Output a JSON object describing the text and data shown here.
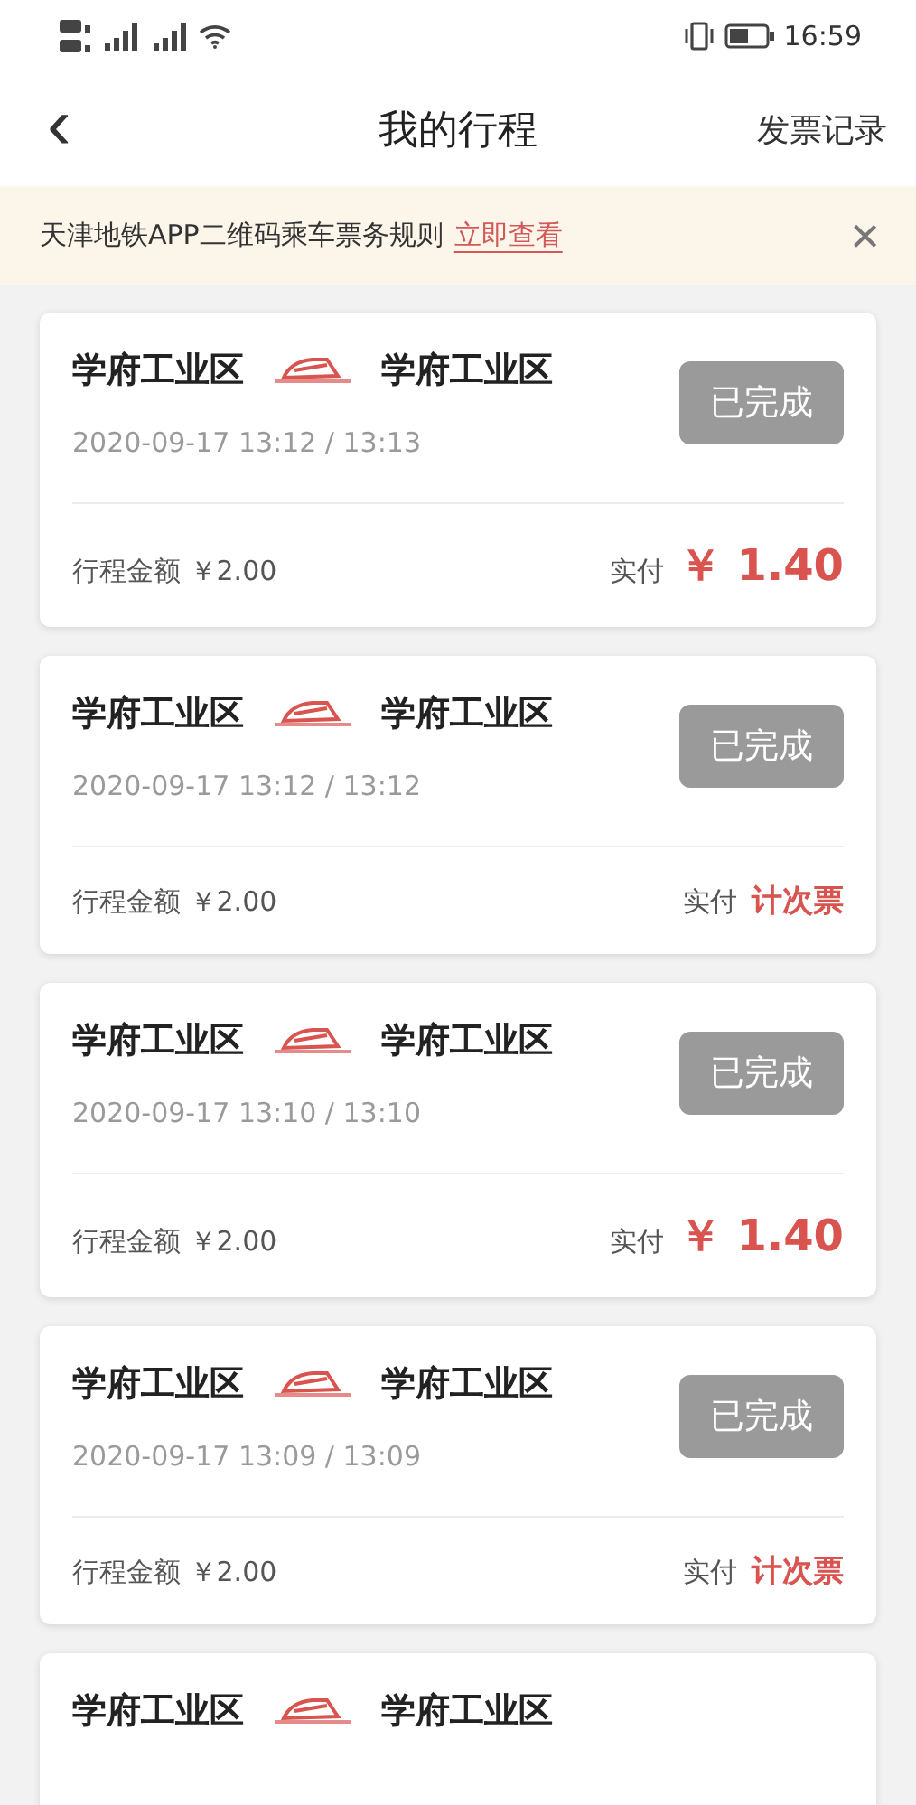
{
  "status_bar": {
    "time": "16:59"
  },
  "nav": {
    "back": "‹",
    "title": "我的行程",
    "action": "发票记录"
  },
  "notice": {
    "text": "天津地铁APP二维码乘车票务规则",
    "link": "立即查看",
    "close": "×"
  },
  "trips": [
    {
      "from": "学府工业区",
      "to": "学府工业区",
      "status": "已完成",
      "time": "2020-09-17 13:12 / 13:13",
      "fare_label": "行程金额",
      "fare": "￥2.00",
      "paid_label": "实付",
      "paid": "￥ 1.40",
      "kind": "amount"
    },
    {
      "from": "学府工业区",
      "to": "学府工业区",
      "status": "已完成",
      "time": "2020-09-17 13:12 / 13:12",
      "fare_label": "行程金额",
      "fare": "￥2.00",
      "paid_label": "实付",
      "paid": "计次票",
      "kind": "count"
    },
    {
      "from": "学府工业区",
      "to": "学府工业区",
      "status": "已完成",
      "time": "2020-09-17 13:10 / 13:10",
      "fare_label": "行程金额",
      "fare": "￥2.00",
      "paid_label": "实付",
      "paid": "￥ 1.40",
      "kind": "amount"
    },
    {
      "from": "学府工业区",
      "to": "学府工业区",
      "status": "已完成",
      "time": "2020-09-17 13:09 / 13:09",
      "fare_label": "行程金额",
      "fare": "￥2.00",
      "paid_label": "实付",
      "paid": "计次票",
      "kind": "count"
    },
    {
      "from": "学府工业区",
      "to": "学府工业区",
      "kind": "partial"
    }
  ]
}
